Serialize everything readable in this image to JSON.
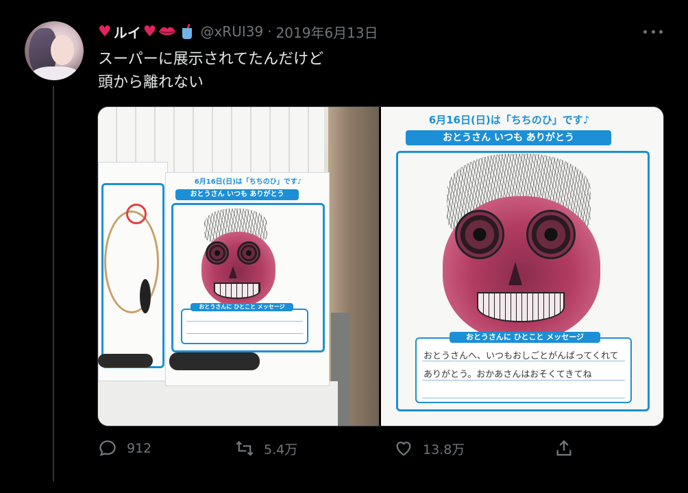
{
  "tweet": {
    "author": {
      "display_name_text": "ルイ",
      "handle": "@xRUI39",
      "separator": "·",
      "date": "2019年6月13日"
    },
    "text_lines": [
      "スーパーに展示されてたんだけど",
      "頭から離れない"
    ],
    "actions": {
      "reply_count": "912",
      "retweet_count": "5.4万",
      "like_count": "13.8万"
    },
    "icons": [
      "heart-emoji-icon",
      "kiss-lips-icon",
      "drink-cup-icon",
      "more-dots-icon",
      "reply-icon",
      "retweet-icon",
      "like-icon",
      "share-icon"
    ],
    "colors": {
      "background": "#000000",
      "text": "#e7e9ea",
      "secondary": "#71767b",
      "heart": "#e0245e",
      "poster_blue": "#1c8fd6"
    }
  },
  "media": {
    "left_photo": {
      "poster_header": "6月16日(日)は「ちちのひ」です♪",
      "poster_banner": "おとうさん いつも ありがとう",
      "poster_message_title": "おとうさんに ひとこと メッセージ"
    },
    "right_photo": {
      "poster_header": "6月16日(日)は「ちちのひ」です♪",
      "poster_banner": "おとうさん いつも ありがとう",
      "poster_message_title": "おとうさんに ひとこと メッセージ",
      "handwritten_message": "おとうさんへ、いつもおしごとがんばってくれてありがとう。おかあさんはおそくてきてね"
    }
  }
}
